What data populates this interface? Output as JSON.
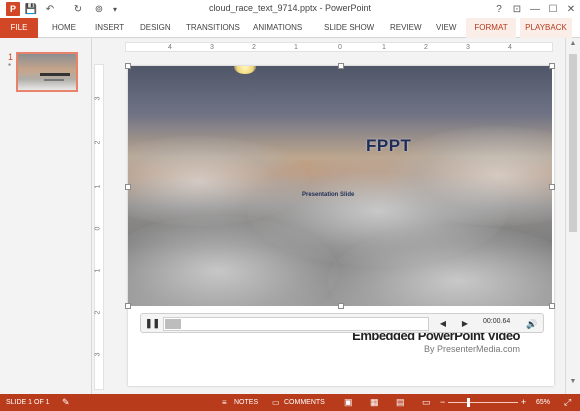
{
  "window": {
    "title": "cloud_race_text_9714.pptx - PowerPoint",
    "help": "?",
    "ribbon_display": "⊡",
    "minimize": "—",
    "maximize": "☐",
    "close": "✕"
  },
  "quick_access": {
    "logo": "P",
    "save": "💾",
    "undo": "↶",
    "redo": "↻",
    "start": "⊚",
    "customize": "▾"
  },
  "ribbon": {
    "tabs": [
      "FILE",
      "HOME",
      "INSERT",
      "DESIGN",
      "TRANSITIONS",
      "ANIMATIONS",
      "SLIDE SHOW",
      "REVIEW",
      "VIEW",
      "FORMAT",
      "PLAYBACK"
    ]
  },
  "thumbnails": {
    "slide_number": "1",
    "star": "*"
  },
  "ruler": {
    "horizontal": [
      "4",
      "3",
      "2",
      "1",
      "0",
      "1",
      "2",
      "3",
      "4"
    ],
    "vertical": [
      "3",
      "2",
      "1",
      "0",
      "1",
      "2",
      "3"
    ]
  },
  "slide": {
    "video_title": "FPPT",
    "video_subtitle": "Presentation Slide",
    "embedded_text": "Embedded PowerPoint Video",
    "byline": "By PresenterMedia.com"
  },
  "media": {
    "pause": "❚❚",
    "back": "◀",
    "forward": "▶",
    "time": "00:00.64",
    "volume": "🔊"
  },
  "status": {
    "slide_indicator": "SLIDE 1 OF 1",
    "notes": "NOTES",
    "comments": "COMMENTS",
    "zoom": "65%",
    "zoom_minus": "−",
    "zoom_plus": "+"
  },
  "colors": {
    "accent": "#d24726",
    "status": "#b83c1c"
  }
}
